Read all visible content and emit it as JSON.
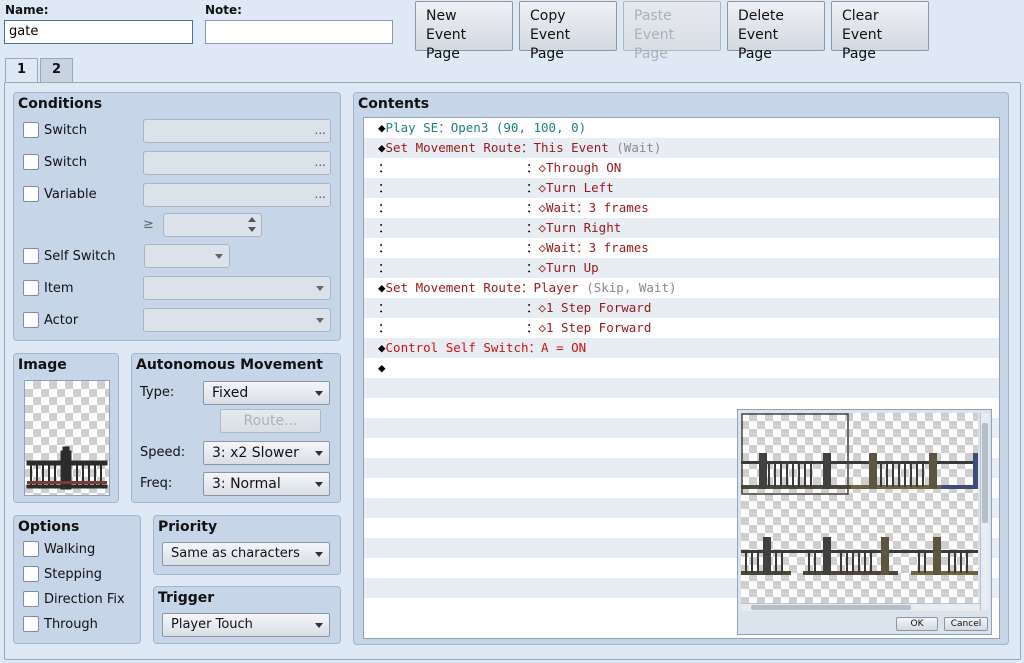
{
  "header": {
    "name_label": "Name:",
    "name_value": "gate",
    "note_label": "Note:",
    "note_value": "",
    "buttons": {
      "new": "New\nEvent Page",
      "copy": "Copy\nEvent Page",
      "paste": "Paste\nEvent Page",
      "delete": "Delete\nEvent Page",
      "clear": "Clear\nEvent Page"
    }
  },
  "tabs": [
    "1",
    "2"
  ],
  "conditions": {
    "title": "Conditions",
    "switch1": "Switch",
    "switch2": "Switch",
    "variable": "Variable",
    "gte": "≥",
    "self_switch": "Self Switch",
    "item": "Item",
    "actor": "Actor",
    "ellipsis": "..."
  },
  "image": {
    "title": "Image"
  },
  "autonomous": {
    "title": "Autonomous Movement",
    "type_label": "Type:",
    "type_value": "Fixed",
    "route_button": "Route...",
    "speed_label": "Speed:",
    "speed_value": "3: x2 Slower",
    "freq_label": "Freq:",
    "freq_value": "3: Normal"
  },
  "options": {
    "title": "Options",
    "walking": "Walking",
    "stepping": "Stepping",
    "direction_fix": "Direction Fix",
    "through": "Through"
  },
  "priority": {
    "title": "Priority",
    "value": "Same as characters"
  },
  "trigger": {
    "title": "Trigger",
    "value": "Player Touch"
  },
  "contents": {
    "title": "Contents",
    "lines": [
      [
        {
          "t": "◆",
          "c": "c-black"
        },
        {
          "t": "Play SE：Open3 (90, 100, 0)",
          "c": "c-teal"
        }
      ],
      [
        {
          "t": "◆",
          "c": "c-black"
        },
        {
          "t": "Set Movement Route：This Event ",
          "c": "c-red"
        },
        {
          "t": "(Wait)",
          "c": "c-gray"
        }
      ],
      [
        {
          "t": "：                  ：",
          "c": "c-black"
        },
        {
          "t": "◇Through ON",
          "c": "c-red"
        }
      ],
      [
        {
          "t": "：                  ：",
          "c": "c-black"
        },
        {
          "t": "◇Turn Left",
          "c": "c-red"
        }
      ],
      [
        {
          "t": "：                  ：",
          "c": "c-black"
        },
        {
          "t": "◇Wait：3 frames",
          "c": "c-red"
        }
      ],
      [
        {
          "t": "：                  ：",
          "c": "c-black"
        },
        {
          "t": "◇Turn Right",
          "c": "c-red"
        }
      ],
      [
        {
          "t": "：                  ：",
          "c": "c-black"
        },
        {
          "t": "◇Wait：3 frames",
          "c": "c-red"
        }
      ],
      [
        {
          "t": "：                  ：",
          "c": "c-black"
        },
        {
          "t": "◇Turn Up",
          "c": "c-red"
        }
      ],
      [
        {
          "t": "◆",
          "c": "c-black"
        },
        {
          "t": "Set Movement Route：Player ",
          "c": "c-red"
        },
        {
          "t": "(Skip, Wait)",
          "c": "c-gray"
        }
      ],
      [
        {
          "t": "：                  ：",
          "c": "c-black"
        },
        {
          "t": "◇1 Step Forward",
          "c": "c-red"
        }
      ],
      [
        {
          "t": "：                  ：",
          "c": "c-black"
        },
        {
          "t": "◇1 Step Forward",
          "c": "c-red"
        }
      ],
      [
        {
          "t": "◆",
          "c": "c-black"
        },
        {
          "t": "Control Self Switch：A = ON",
          "c": "c-bright"
        }
      ],
      [
        {
          "t": "◆",
          "c": "c-black"
        }
      ]
    ],
    "empty_rows": 11
  },
  "popup": {
    "ok": "OK",
    "cancel": "Cancel"
  }
}
